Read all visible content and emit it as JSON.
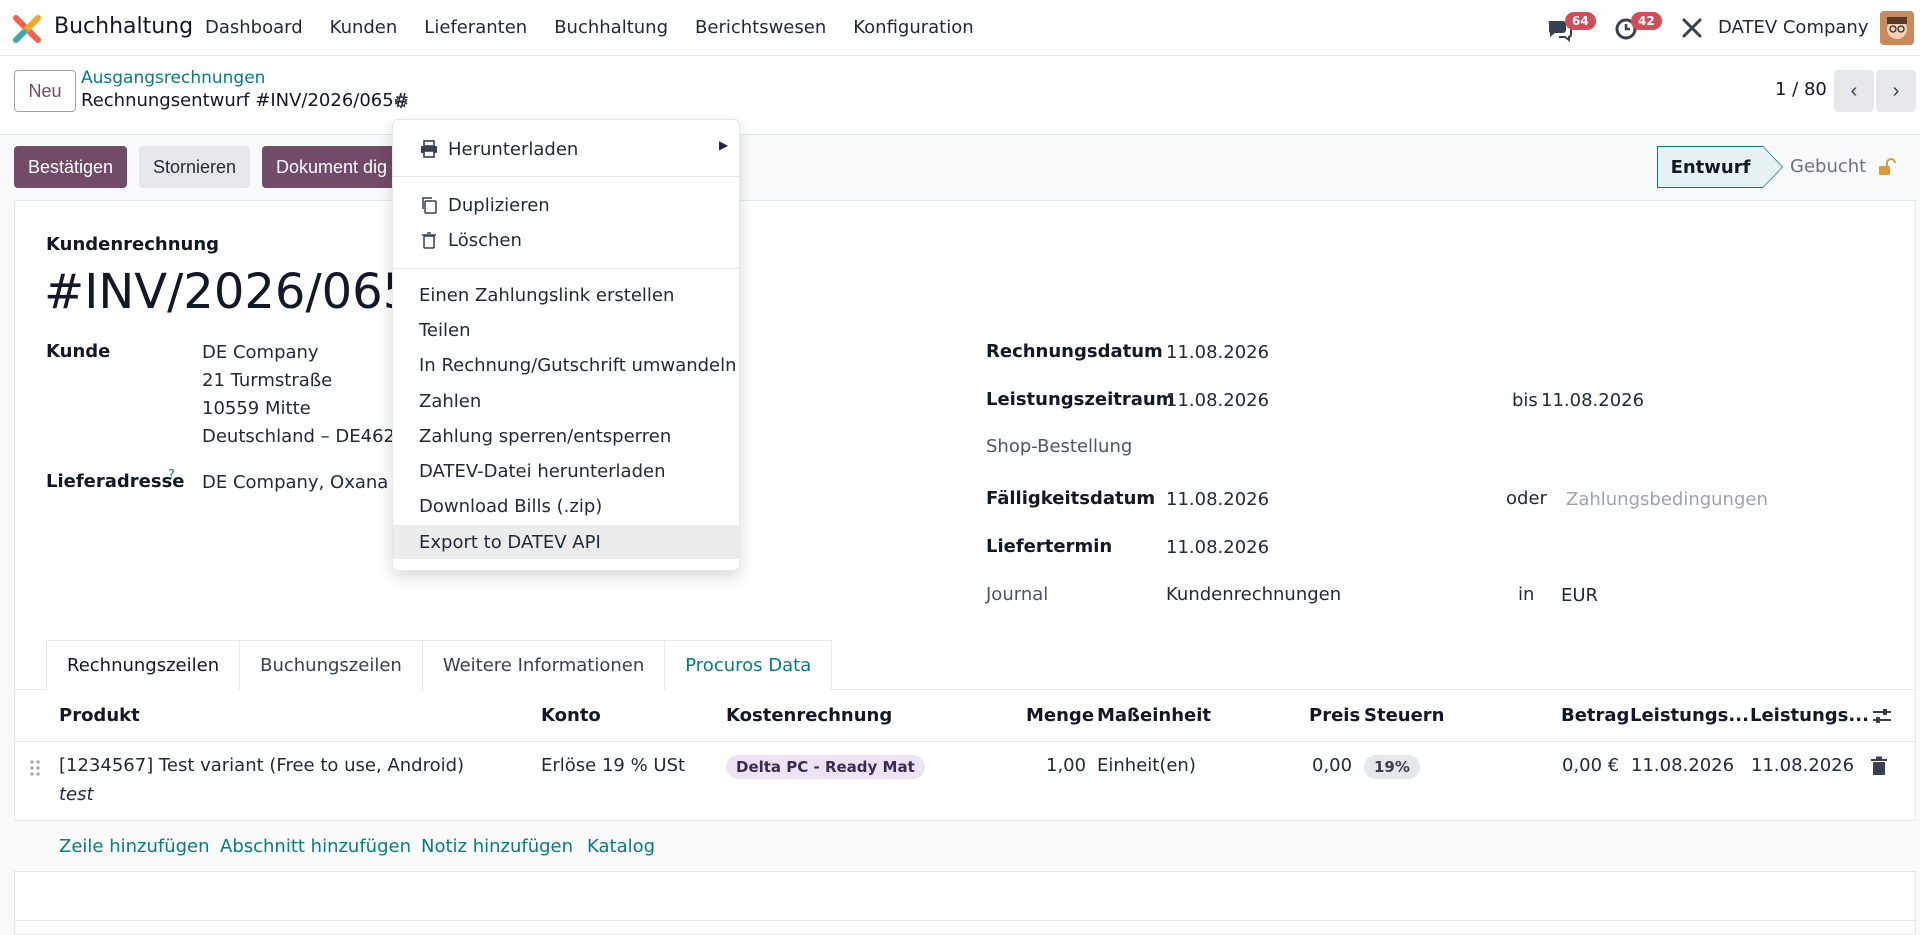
{
  "navbar": {
    "app_name": "Buchhaltung",
    "menu": [
      "Dashboard",
      "Kunden",
      "Lieferanten",
      "Buchhaltung",
      "Berichtswesen",
      "Konfiguration"
    ],
    "messages_count": "64",
    "activities_count": "42",
    "company": "DATEV Company"
  },
  "control": {
    "new_label": "Neu",
    "breadcrumb_parent": "Ausgangsrechnungen",
    "breadcrumb_current": "Rechnungsentwurf #INV/2026/065#",
    "pager": "1 / 80"
  },
  "actions": {
    "confirm": "Bestätigen",
    "cancel": "Stornieren",
    "digitize": "Dokument dig"
  },
  "status": {
    "current": "Entwurf",
    "next": "Gebucht"
  },
  "form": {
    "doc_type": "Kundenrechnung",
    "title": "#INV/2026/065#",
    "customer_label": "Kunde",
    "customer_lines": [
      "DE Company",
      "21 Turmstraße",
      "10559 Mitte",
      "Deutschland – DE4626"
    ],
    "delivery_label": "Lieferadresse",
    "delivery_help": "?",
    "delivery_value": "DE Company, Oxana",
    "invoice_date_label": "Rechnungsdatum",
    "invoice_date": "11.08.2026",
    "service_period_label": "Leistungszeitraum",
    "service_from": "11.08.2026",
    "service_to_prefix": "bis",
    "service_to": "11.08.2026",
    "shop_order_label": "Shop-Bestellung",
    "due_date_label": "Fälligkeitsdatum",
    "due_date": "11.08.2026",
    "due_or": "oder",
    "payment_terms_placeholder": "Zahlungsbedingungen",
    "delivery_date_label": "Liefertermin",
    "delivery_date": "11.08.2026",
    "journal_label": "Journal",
    "journal": "Kundenrechnungen",
    "currency_in": "in",
    "currency": "EUR"
  },
  "tabs": [
    "Rechnungszeilen",
    "Buchungszeilen",
    "Weitere Informationen",
    "Procuros Data"
  ],
  "table": {
    "headers": [
      "Produkt",
      "Konto",
      "Kostenrechnung",
      "Menge",
      "Maßeinheit",
      "Preis",
      "Steuern",
      "Betrag",
      "Leistungs...",
      "Leistungs..."
    ],
    "rows": [
      {
        "product": "[1234567] Test variant (Free to use, Android)",
        "note": "test",
        "account": "Erlöse 19 % USt",
        "analytic": "Delta PC - Ready Mat",
        "quantity": "1,00",
        "uom": "Einheit(en)",
        "price": "0,00",
        "tax": "19%",
        "amount": "0,00 €",
        "start": "11.08.2026",
        "end": "11.08.2026"
      }
    ],
    "add_links": [
      "Zeile hinzufügen",
      "Abschnitt hinzufügen",
      "Notiz hinzufügen",
      "Katalog"
    ]
  },
  "dropdown": {
    "items": [
      "Herunterladen",
      "Duplizieren",
      "Löschen",
      "Einen Zahlungslink erstellen",
      "Teilen",
      "In Rechnung/Gutschrift umwandeln",
      "Zahlen",
      "Zahlung sperren/entsperren",
      "DATEV-Datei herunterladen",
      "Download Bills (.zip)",
      "Export to DATEV API"
    ]
  },
  "colors": {
    "primary": "#714b67",
    "accent": "#017e84",
    "badge": "#d44c59"
  }
}
